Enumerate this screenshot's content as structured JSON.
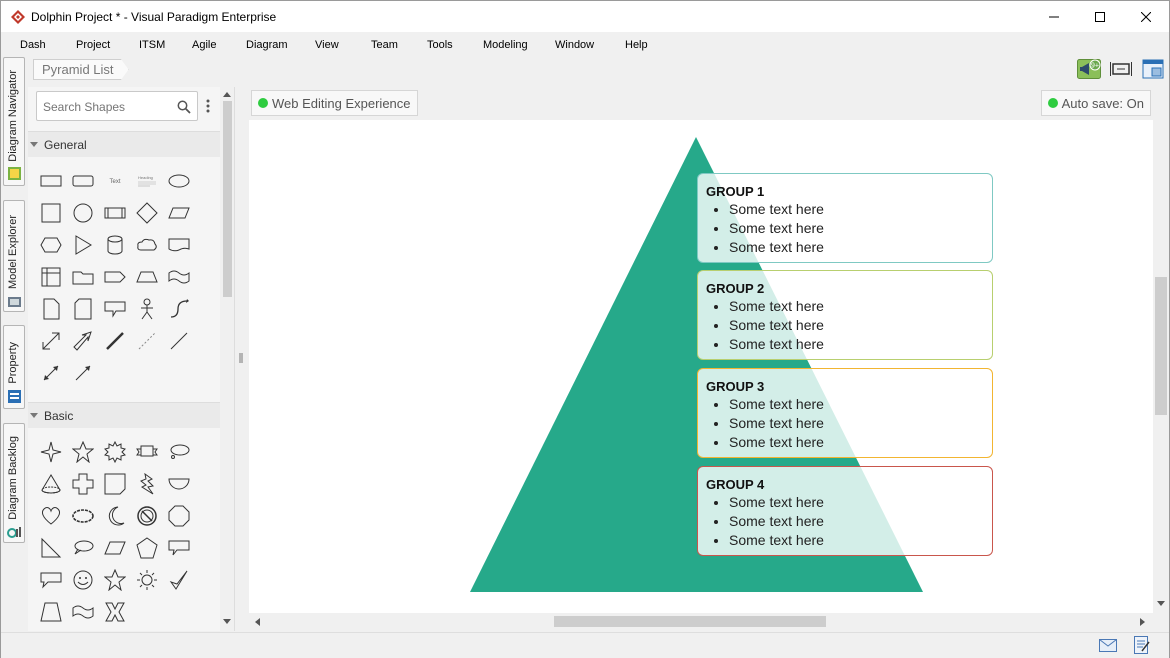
{
  "window": {
    "title": "Dolphin Project * - Visual Paradigm Enterprise",
    "minimize_icon": "minimize-icon",
    "maximize_icon": "maximize-icon",
    "close_icon": "close-icon"
  },
  "menu": [
    "Dash",
    "Project",
    "ITSM",
    "Agile",
    "Diagram",
    "View",
    "Team",
    "Tools",
    "Modeling",
    "Window",
    "Help"
  ],
  "side_tabs": [
    {
      "label": "Diagram Navigator",
      "icon": "diagram-navigator-icon"
    },
    {
      "label": "Model Explorer",
      "icon": "model-explorer-icon"
    },
    {
      "label": "Property",
      "icon": "property-icon"
    },
    {
      "label": "Diagram Backlog",
      "icon": "diagram-backlog-icon"
    }
  ],
  "breadcrumb": "Pyramid List",
  "top_right_tools": {
    "notification_badge": "9+",
    "icons": [
      "announcement-icon",
      "fit-diagram-icon",
      "diagram-overview-icon"
    ]
  },
  "shape_panel": {
    "search_placeholder": "Search Shapes",
    "categories": [
      {
        "label": "General"
      },
      {
        "label": "Basic"
      }
    ],
    "general_text_shape": "Text",
    "general_heading_shape": "Heading"
  },
  "canvas": {
    "web_editing_label": "Web Editing Experience",
    "autosave_label": "Auto save: On",
    "pyramid_color": "#26a98a",
    "groups": [
      {
        "title": "GROUP 1",
        "items": [
          "Some text here",
          "Some text here",
          "Some text here"
        ],
        "border": "#7fc9c3"
      },
      {
        "title": "GROUP 2",
        "items": [
          "Some text here",
          "Some text here",
          "Some text here"
        ],
        "border": "#b8cf6f"
      },
      {
        "title": "GROUP 3",
        "items": [
          "Some text here",
          "Some text here",
          "Some text here"
        ],
        "border": "#f2b531"
      },
      {
        "title": "GROUP 4",
        "items": [
          "Some text here",
          "Some text here",
          "Some text here"
        ],
        "border": "#c9564c"
      }
    ]
  },
  "statusbar": {
    "icons": [
      "mail-icon",
      "notes-icon"
    ]
  }
}
